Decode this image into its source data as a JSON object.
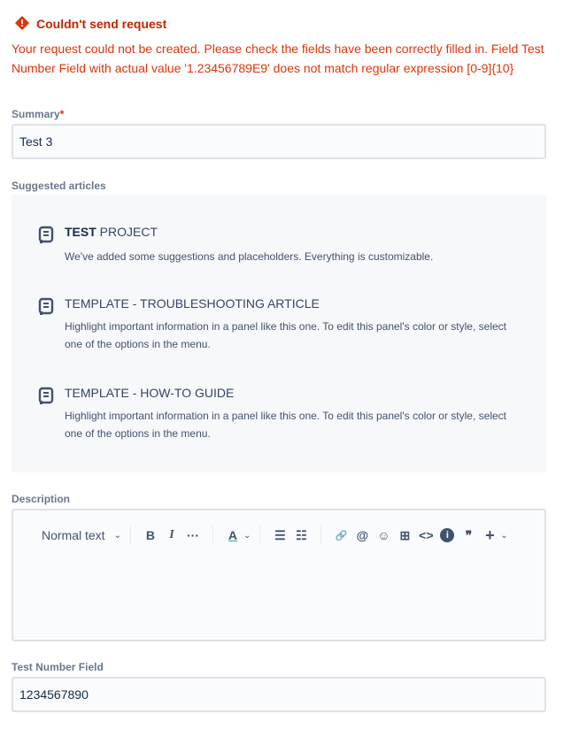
{
  "error": {
    "title": "Couldn't send request",
    "message": "Your request could not be created. Please check the fields have been correctly filled in. Field Test Number Field with actual value '1.23456789E9' does not match regular expression [0-9]{10}",
    "color": "#de350b"
  },
  "summary": {
    "label": "Summary",
    "required": "*",
    "value": "Test 3"
  },
  "suggested": {
    "label": "Suggested articles",
    "articles": [
      {
        "title_bold": "TEST",
        "title": " PROJECT",
        "desc": "We've added some suggestions and placeholders. Everything is customizable."
      },
      {
        "title_bold": "",
        "title": "TEMPLATE - TROUBLESHOOTING ARTICLE",
        "desc": "Highlight important information in a panel like this one. To edit this panel's color or style, select one of the options in the menu."
      },
      {
        "title_bold": "",
        "title": "TEMPLATE - HOW-TO GUIDE",
        "desc": "Highlight important information in a panel like this one. To edit this panel's color or style, select one of the options in the menu."
      }
    ]
  },
  "description": {
    "label": "Description",
    "toolbar": {
      "text_style": "Normal text",
      "bold": "B",
      "italic": "I",
      "more": "···",
      "color": "A",
      "link": "🔗",
      "mention": "@",
      "emoji": "☺",
      "table": "⊞",
      "code": "<>",
      "info": "i",
      "quote": "❞",
      "insert": "+"
    }
  },
  "test_number": {
    "label": "Test Number Field",
    "value": "1234567890"
  }
}
